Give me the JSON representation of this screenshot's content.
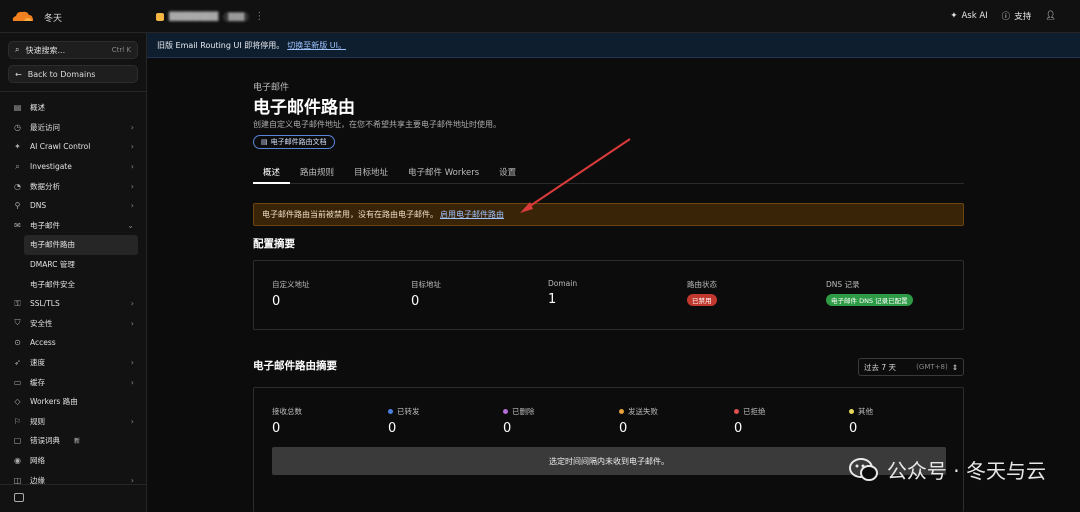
{
  "topbar": {
    "account": "冬天",
    "ask_ai": "Ask AI",
    "support": "支持"
  },
  "sidebar": {
    "search_placeholder": "快速搜索...",
    "search_shortcut": "Ctrl K",
    "back": "Back to Domains",
    "items": [
      {
        "label": "概述",
        "icon": "overview-icon",
        "chevron": false
      },
      {
        "label": "最近访问",
        "icon": "clock-icon",
        "chevron": true
      },
      {
        "label": "AI Crawl Control",
        "icon": "ai-icon",
        "chevron": true
      },
      {
        "label": "Investigate",
        "icon": "investigate-icon",
        "chevron": true
      },
      {
        "label": "数据分析",
        "icon": "analytics-icon",
        "chevron": true
      },
      {
        "label": "DNS",
        "icon": "dns-icon",
        "chevron": true
      },
      {
        "label": "电子邮件",
        "icon": "email-icon",
        "chevron": true,
        "expanded": true
      }
    ],
    "email_sub": [
      {
        "label": "电子邮件路由",
        "active": true
      },
      {
        "label": "DMARC 管理",
        "active": false
      },
      {
        "label": "电子邮件安全",
        "active": false
      }
    ],
    "items2": [
      {
        "label": "SSL/TLS",
        "icon": "lock-icon",
        "chevron": true
      },
      {
        "label": "安全性",
        "icon": "shield-icon",
        "chevron": true
      },
      {
        "label": "Access",
        "icon": "access-icon",
        "chevron": false
      },
      {
        "label": "速度",
        "icon": "speed-icon",
        "chevron": true
      },
      {
        "label": "缓存",
        "icon": "cache-icon",
        "chevron": true
      },
      {
        "label": "Workers 路由",
        "icon": "workers-icon",
        "chevron": false
      },
      {
        "label": "规则",
        "icon": "rules-icon",
        "chevron": true
      },
      {
        "label": "错误词典",
        "icon": "error-icon",
        "chevron": false,
        "badge": "新"
      },
      {
        "label": "网络",
        "icon": "network-icon",
        "chevron": false
      },
      {
        "label": "边缘",
        "icon": "edge-icon",
        "chevron": true
      }
    ]
  },
  "banner": {
    "text": "旧版 Email Routing UI 即将停用。",
    "link": "切换至新版 UI。"
  },
  "page": {
    "crumb": "电子邮件",
    "title": "电子邮件路由",
    "description": "创建自定义电子邮件地址，在您不希望共享主要电子邮件地址时使用。",
    "doc_button": "电子邮件路由文档"
  },
  "tabs": [
    {
      "label": "概述",
      "active": true
    },
    {
      "label": "路由规则",
      "active": false
    },
    {
      "label": "目标地址",
      "active": false
    },
    {
      "label": "电子邮件 Workers",
      "active": false
    },
    {
      "label": "设置",
      "active": false
    }
  ],
  "warning": {
    "text": "电子邮件路由当前被禁用，没有在路由电子邮件。",
    "link": "启用电子邮件路由"
  },
  "config_summary": {
    "title": "配置摘要",
    "stats": [
      {
        "label": "自定义地址",
        "value": "0"
      },
      {
        "label": "目标地址",
        "value": "0"
      },
      {
        "label": "Domain",
        "value": "1"
      },
      {
        "label": "路由状态",
        "badge": "已禁用"
      },
      {
        "label": "DNS 记录",
        "badge": "电子邮件 DNS 记录已配置"
      }
    ]
  },
  "routing_summary": {
    "title": "电子邮件路由摘要",
    "range_label": "过去 7 天",
    "timezone": "(GMT+8)",
    "stats": [
      {
        "label": "接收总数",
        "value": "0",
        "dot": ""
      },
      {
        "label": "已转发",
        "value": "0",
        "dot": "#4a7fe0"
      },
      {
        "label": "已删除",
        "value": "0",
        "dot": "#b46fd9"
      },
      {
        "label": "发送失败",
        "value": "0",
        "dot": "#e8a23a"
      },
      {
        "label": "已拒绝",
        "value": "0",
        "dot": "#e05252"
      },
      {
        "label": "其他",
        "value": "0",
        "dot": "#e8d85a"
      }
    ],
    "empty_message": "选定时间间隔内未收到电子邮件。"
  },
  "watermark": {
    "text": "公众号 · 冬天与云"
  }
}
